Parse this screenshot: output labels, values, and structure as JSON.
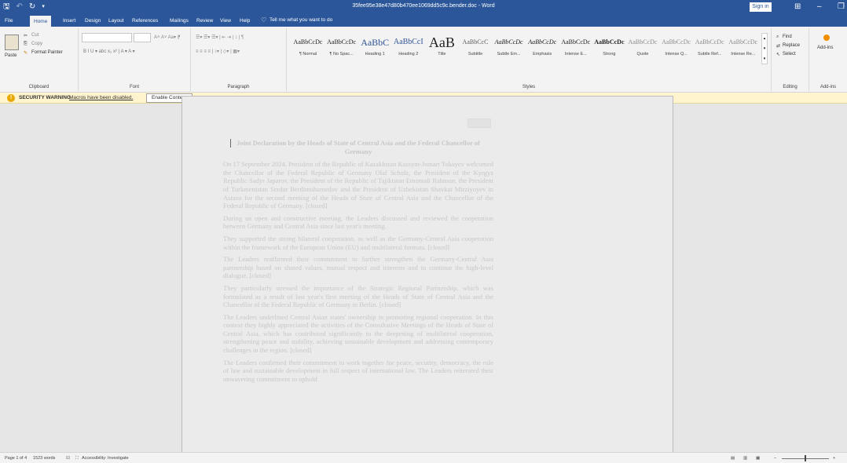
{
  "window": {
    "title": "35fee95e38e47d80b470ee1069dd5c9c.bender.doc - Word",
    "signin": "Sign in"
  },
  "quick_access": {
    "save_icon": "save-icon",
    "undo_icon": "undo-icon",
    "redo_icon": "redo-icon"
  },
  "tabs": [
    "File",
    "Home",
    "Insert",
    "Design",
    "Layout",
    "References",
    "Mailings",
    "Review",
    "View",
    "Help"
  ],
  "active_tab": "Home",
  "tellme": "Tell me what you want to do",
  "ribbon": {
    "clipboard": {
      "label": "Clipboard",
      "paste": "Paste",
      "cut": "Cut",
      "copy": "Copy",
      "format_painter": "Format Painter"
    },
    "font": {
      "label": "Font"
    },
    "paragraph": {
      "label": "Paragraph"
    },
    "styles": {
      "label": "Styles",
      "items": [
        {
          "sample": "AaBbCcDc",
          "name": "¶ Normal"
        },
        {
          "sample": "AaBbCcDc",
          "name": "¶ No Spac..."
        },
        {
          "sample": "AaBbC",
          "name": "Heading 1"
        },
        {
          "sample": "AaBbCcI",
          "name": "Heading 2"
        },
        {
          "sample": "AaB",
          "name": "Title"
        },
        {
          "sample": "AaBbCcC",
          "name": "Subtitle"
        },
        {
          "sample": "AaBbCcDc",
          "name": "Subtle Em..."
        },
        {
          "sample": "AaBbCcDc",
          "name": "Emphasis"
        },
        {
          "sample": "AaBbCcDc",
          "name": "Intense E..."
        },
        {
          "sample": "AaBbCcDc",
          "name": "Strong"
        },
        {
          "sample": "AaBbCcDc",
          "name": "Quote"
        },
        {
          "sample": "AaBbCcDc",
          "name": "Intense Q..."
        },
        {
          "sample": "AaBbCcDc",
          "name": "Subtle Ref..."
        },
        {
          "sample": "AaBbCcDc",
          "name": "Intense Re..."
        }
      ]
    },
    "editing": {
      "label": "Editing",
      "find": "Find",
      "replace": "Replace",
      "select": "Select"
    },
    "addins": {
      "label": "Add-ins",
      "button": "Add-ins"
    }
  },
  "security": {
    "title": "SECURITY WARNING",
    "message": "Macros have been disabled.",
    "button": "Enable Content"
  },
  "document": {
    "title": "Joint Declaration by the Heads of State of Central Asia and the Federal Chancellor of Germany",
    "paragraphs": [
      "On 17 September 2024, President of the Republic of Kazakhstan Kassym-Jomart Tokayev welcomed the Chancellor of the Federal Republic of Germany Olaf Scholz, the President of the Kyrgyz Republic Sadyr Japarov, the President of the Republic of Tajikistan Emomali Rahmon, the President of Turkmenistan Serdar Berdimuhamedov and the President of Uzbekistan Shavkat Mirziyoyev in Astana for the second meeting of the Heads of State of Central Asia and the Chancellor of the Federal Republic of Germany. [closed]",
      "During an open and constructive meeting, the Leaders discussed and reviewed the cooperation between Germany and Central Asia since last year's meeting.",
      "They supported the strong bilateral cooperation, as well as the Germany-Central Asia cooperation within the framework of the European Union (EU) and multilateral formats. [closed]",
      "The Leaders reaffirmed their commitment to further strengthen the Germany-Central Asia partnership based on shared values, mutual respect and interests and to continue the high-level dialogue. [closed]",
      "They particularly stressed the importance of the Strategic Regional Partnership, which was formulated as a result of last year's first meeting of the Heads of State of Central Asia and the Chancellor of the Federal Republic of Germany in Berlin. [closed]",
      "The Leaders underlined Central Asian states' ownership in promoting regional cooperation. In this context they highly appreciated the activities of the Consultative Meetings of the Heads of State of Central Asia, which has contributed significantly to the deepening of multilateral cooperation, strengthening peace and stability, achieving sustainable development and addressing contemporary challenges in the region. [closed]",
      "The Leaders confirmed their commitment to work together for peace, security, democracy, the rule of law and sustainable development in full respect of international law. The Leaders reiterated their unwavering commitment to uphold"
    ]
  },
  "status": {
    "page": "Page 1 of 4",
    "words": "1523 words",
    "accessibility": "Accessibility: Investigate"
  }
}
